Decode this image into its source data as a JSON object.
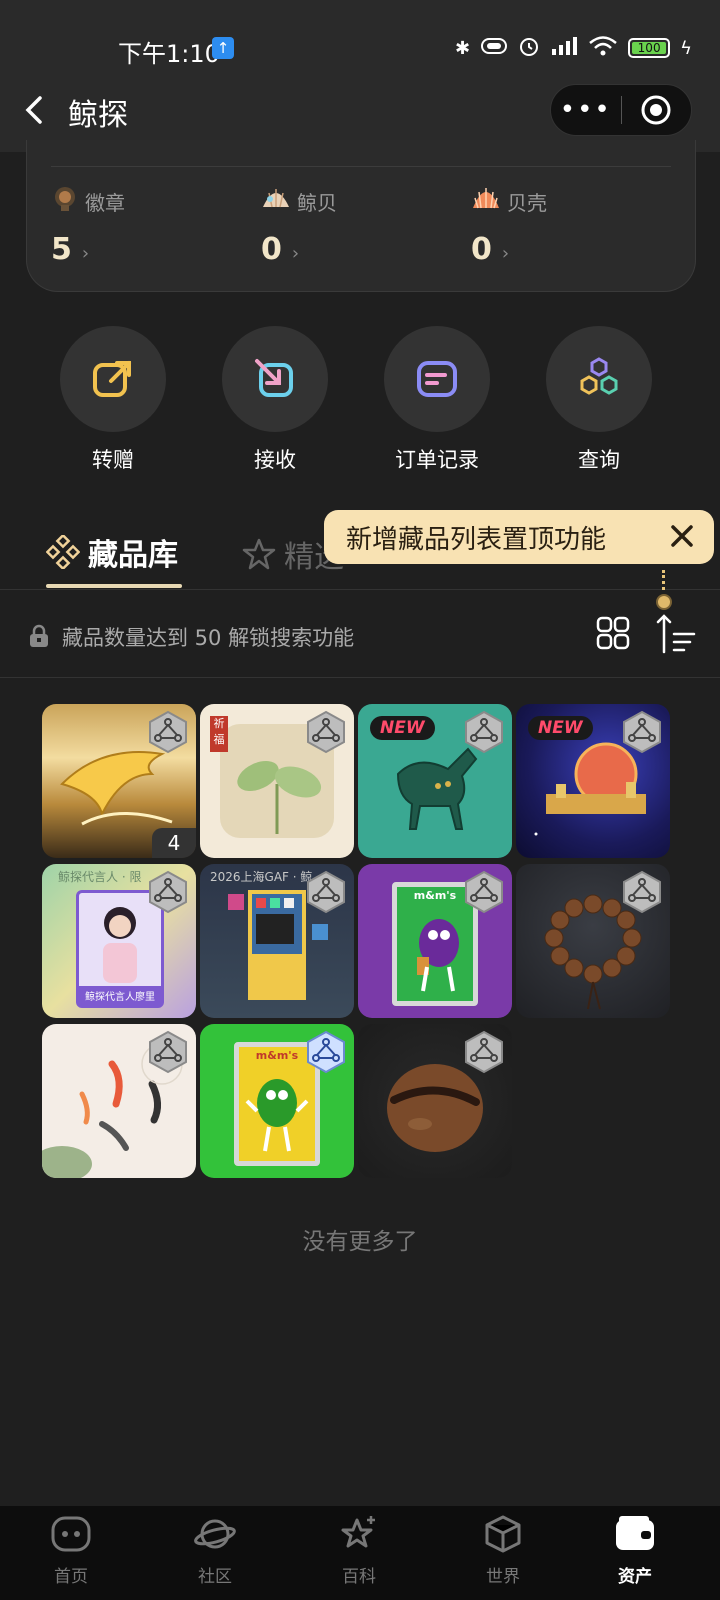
{
  "status_bar": {
    "time": "下午1:10",
    "upload_icon": "upload-icon",
    "battery": "100"
  },
  "header": {
    "title": "鲸探",
    "more_label": "•••"
  },
  "stats": [
    {
      "label": "徽章",
      "value": "5",
      "icon": "badge-icon"
    },
    {
      "label": "鲸贝",
      "value": "0",
      "icon": "shell-icon"
    },
    {
      "label": "贝壳",
      "value": "0",
      "icon": "scallop-icon"
    }
  ],
  "actions": [
    {
      "label": "转赠",
      "icon": "share-out-icon"
    },
    {
      "label": "接收",
      "icon": "receive-icon"
    },
    {
      "label": "订单记录",
      "icon": "order-icon"
    },
    {
      "label": "查询",
      "icon": "query-icon"
    }
  ],
  "tabs": {
    "active": "藏品库",
    "second": "精选"
  },
  "tooltip": {
    "text": "新增藏品列表置顶功能"
  },
  "lock_row": {
    "text": "藏品数量达到 50 解锁搜索功能"
  },
  "items": [
    {
      "name": "golden-whale",
      "new": false,
      "count": "4"
    },
    {
      "name": "sprout",
      "new": false,
      "count": "",
      "tag": "祈福"
    },
    {
      "name": "jade-horse",
      "new": true,
      "count": ""
    },
    {
      "name": "space-city",
      "new": true,
      "count": ""
    },
    {
      "name": "spokesperson-card",
      "new": false,
      "count": "",
      "caption_top": "鲸探代言人 · 限",
      "caption_bottom": "鲸探代言人廖里"
    },
    {
      "name": "gaf-poster",
      "new": false,
      "count": "",
      "caption_top": "2026上海GAF · 鲸"
    },
    {
      "name": "mms-purple",
      "new": false,
      "count": "",
      "brand": "m&m's"
    },
    {
      "name": "bead-bracelet",
      "new": false,
      "count": ""
    },
    {
      "name": "koi-fish",
      "new": false,
      "count": ""
    },
    {
      "name": "mms-green",
      "new": false,
      "count": "",
      "brand": "m&m's"
    },
    {
      "name": "walnut",
      "new": false,
      "count": ""
    }
  ],
  "new_label": "NEW",
  "footer_text": "没有更多了",
  "bottom_nav": [
    {
      "label": "首页",
      "icon": "home-icon",
      "active": false
    },
    {
      "label": "社区",
      "icon": "planet-icon",
      "active": false
    },
    {
      "label": "百科",
      "icon": "encyclopedia-icon",
      "active": false
    },
    {
      "label": "世界",
      "icon": "cube-icon",
      "active": false
    },
    {
      "label": "资产",
      "icon": "wallet-icon",
      "active": true
    }
  ]
}
